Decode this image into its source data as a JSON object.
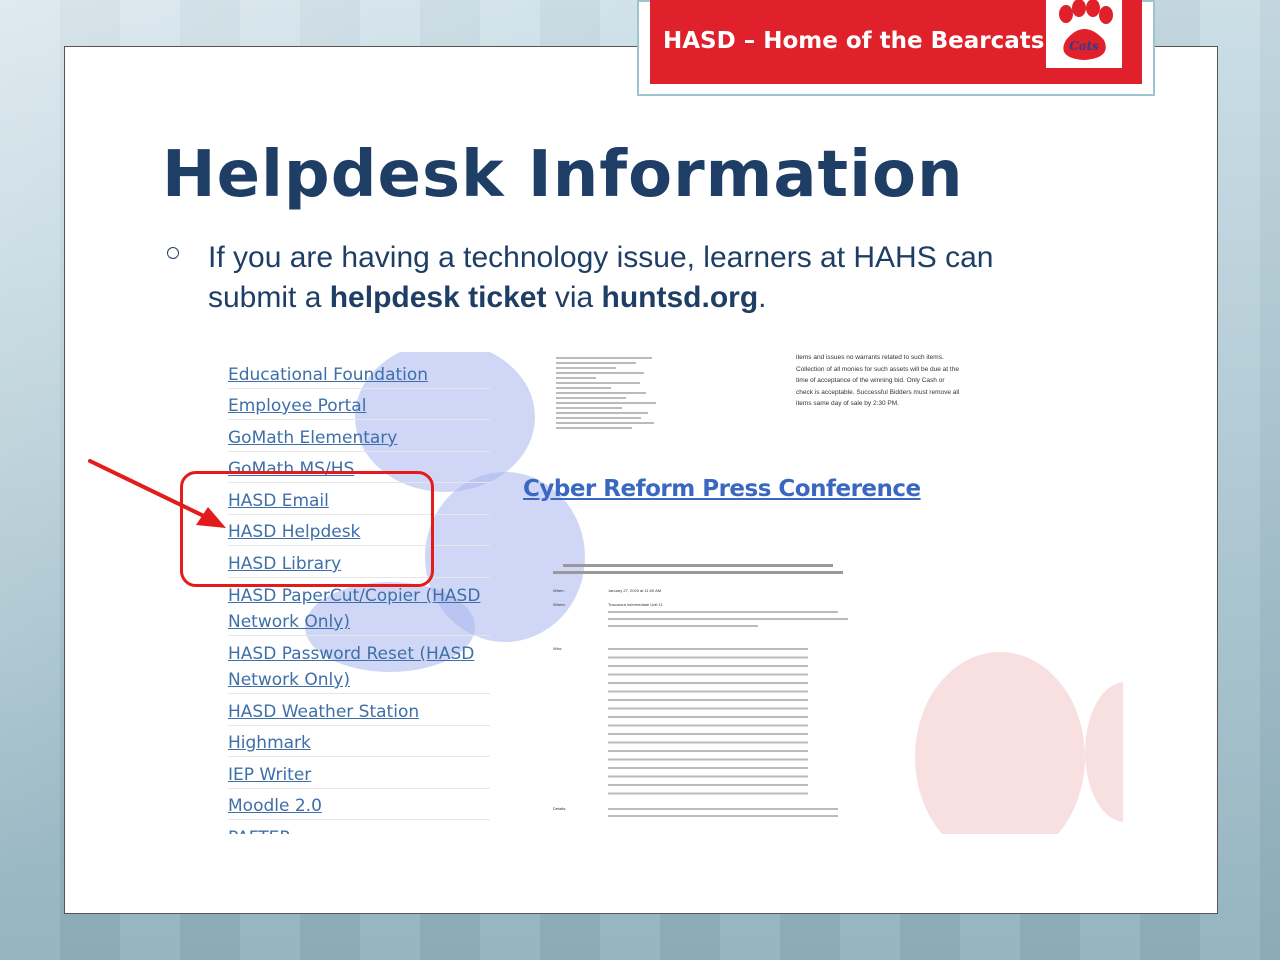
{
  "banner": {
    "text": "HASD – Home of the Bearcats",
    "logo_text": "Cats",
    "color": "#e0202a"
  },
  "slide": {
    "title": "Helpdesk Information",
    "bullet": {
      "part1": "If you are having a technology issue, learners at HAHS can submit a ",
      "bold1": "helpdesk ticket",
      "part2": " via ",
      "bold2": "huntsd.org",
      "part3": "."
    }
  },
  "screenshot": {
    "links": [
      "Educational Foundation",
      "Employee Portal",
      "GoMath Elementary",
      "GoMath MS/HS",
      "HASD Email",
      "HASD Helpdesk",
      "HASD Library",
      "HASD PaperCut/Copier (HASD",
      "Network Only)",
      "HASD Password Reset (HASD",
      "Network Only)",
      "HASD Weather Station",
      "Highmark",
      "IEP Writer",
      "Moodle 2.0",
      "PAFTER"
    ],
    "notice_lines": [
      "items and issues no warrants related to such items.",
      "Collection of all monies for such assets will be due at the",
      "time of acceptance of the winning bid. Only Cash or",
      "check is acceptable. Successful Bidders must remove all",
      "items same day of sale by 2:30 PM."
    ],
    "press_title": "Cyber Reform Press Conference",
    "press_when_label": "When:",
    "press_when": "January 27, 2020 at 11:00 AM",
    "press_where_label": "Where:",
    "press_where": "Tuscarora Intermediate Unit 11",
    "press_who_label": "Who:",
    "press_details_label": "Details:"
  },
  "annotation": {
    "highlight_color": "#e31b1b"
  }
}
